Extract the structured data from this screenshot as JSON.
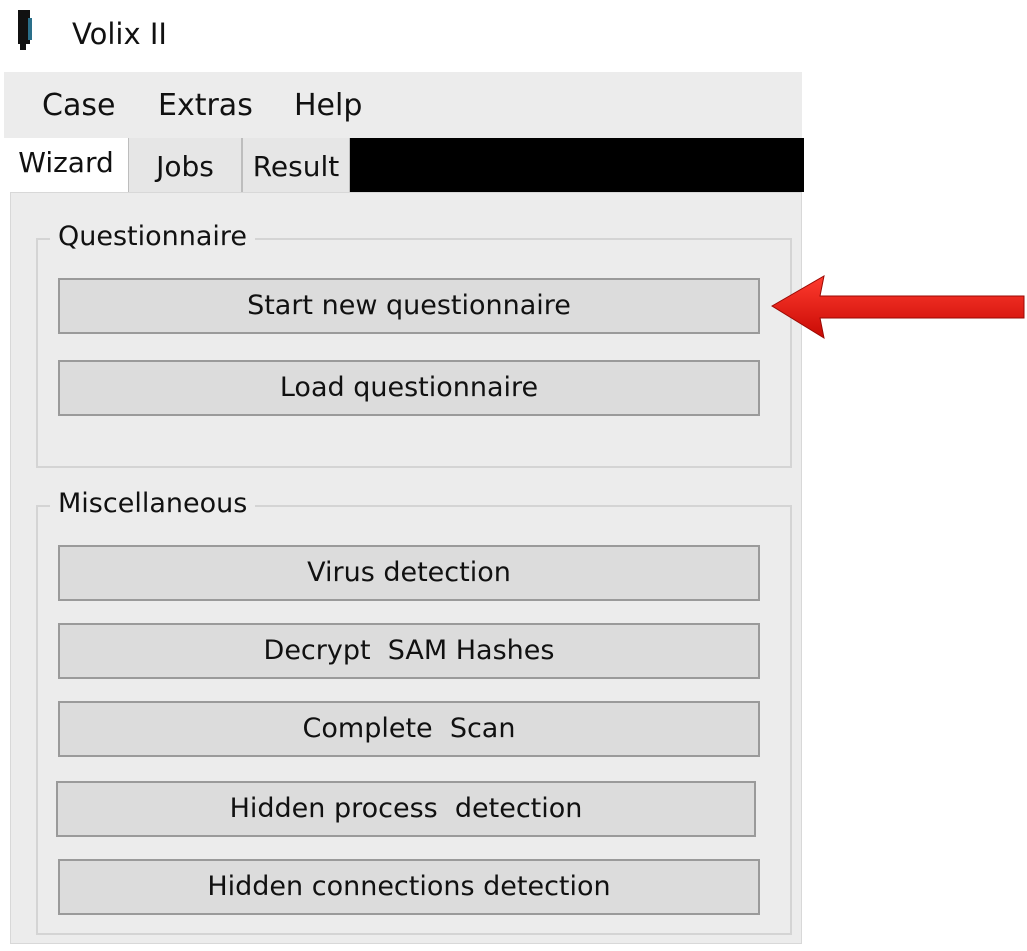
{
  "window": {
    "title": "Volix II",
    "icon": "app-icon"
  },
  "menu": {
    "items": [
      {
        "label": "Case"
      },
      {
        "label": "Extras"
      },
      {
        "label": "Help"
      }
    ]
  },
  "tabs": [
    {
      "label": "Wizard",
      "active": true
    },
    {
      "label": "Jobs",
      "active": false
    },
    {
      "label": "Result",
      "active": false
    }
  ],
  "questionnaire": {
    "title": "Questionnaire",
    "buttons": [
      {
        "label": "Start new questionnaire"
      },
      {
        "label": "Load questionnaire"
      }
    ]
  },
  "miscellaneous": {
    "title": "Miscellaneous",
    "buttons": [
      {
        "label": "Virus detection"
      },
      {
        "label": "Decrypt  SAM Hashes"
      },
      {
        "label": "Complete  Scan"
      },
      {
        "label": "Hidden process  detection"
      },
      {
        "label": "Hidden connections detection"
      }
    ]
  },
  "annotation": {
    "arrow_color": "#e8140c",
    "icon": "arrow-left-icon"
  },
  "colors": {
    "panel_bg": "#ececec",
    "button_bg": "#dcdcdc",
    "tab_strip_bg": "#000000"
  }
}
